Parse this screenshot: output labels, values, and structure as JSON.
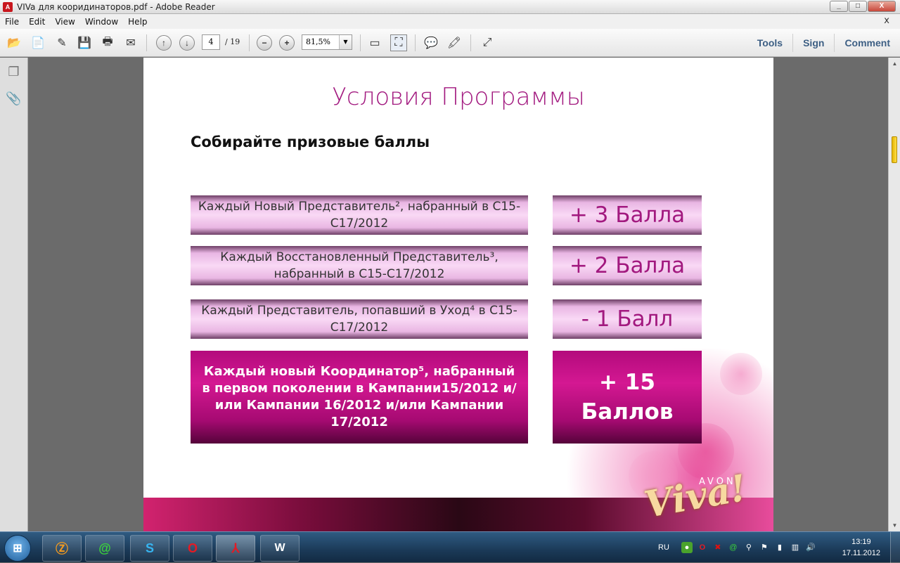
{
  "window": {
    "title": "VIVa для кооридинаторов.pdf - Adobe Reader",
    "controls": [
      "_",
      "□",
      "X"
    ]
  },
  "menu": {
    "items": [
      "File",
      "Edit",
      "View",
      "Window",
      "Help"
    ],
    "close": "x"
  },
  "toolbar": {
    "page_current": "4",
    "page_separator": "/",
    "page_total": "19",
    "zoom": "81,5%",
    "right_links": [
      "Tools",
      "Sign",
      "Comment"
    ]
  },
  "document": {
    "title": "Условия Программы",
    "subtitle": "Собирайте призовые баллы",
    "rows": [
      {
        "condition": "Каждый Новый Представитель², набранный в С15-С17/2012",
        "points": "+ 3 Балла"
      },
      {
        "condition": "Каждый Восстановленный Представитель³, набранный в С15-С17/2012",
        "points": "+ 2 Балла"
      },
      {
        "condition": "Каждый Представитель, попавший в Уход⁴  в С15-С17/2012",
        "points": "- 1 Балл"
      },
      {
        "condition": "Каждый новый Координатор⁵, набранный в первом поколении в Кампании15/2012 и/или Кампании 16/2012 и/или Кампании 17/2012",
        "points": "+ 15 Баллов"
      }
    ],
    "brand": "AVON",
    "logo": "Viva!"
  },
  "taskbar": {
    "language": "RU",
    "time": "13:19",
    "date": "17.11.2012"
  },
  "colors": {
    "accent": "#a2197f",
    "highlight_box": "#c40f86",
    "scroll_thumb": "#ffde4a"
  }
}
